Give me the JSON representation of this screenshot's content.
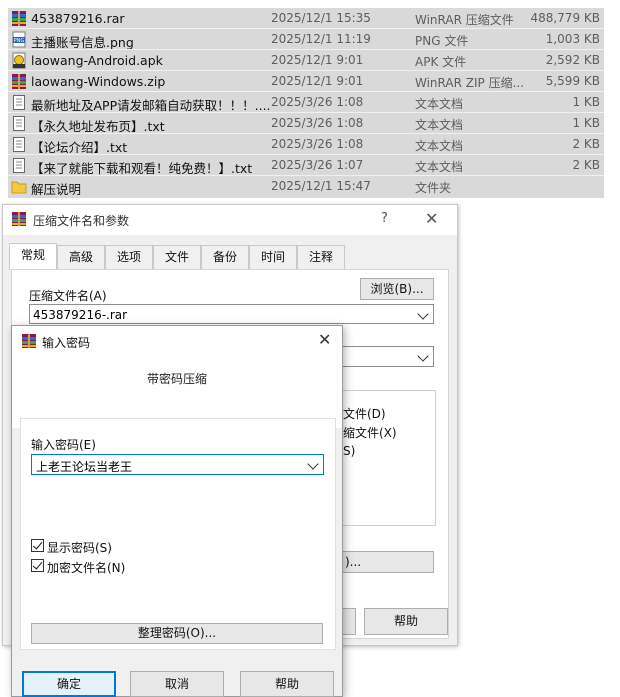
{
  "file_list": [
    {
      "name": "453879216.rar",
      "date": "2025/12/1 15:35",
      "type": "WinRAR 压缩文件",
      "size": "488,779 KB",
      "icon": "rar-icon"
    },
    {
      "name": "主播账号信息.png",
      "date": "2025/12/1 11:19",
      "type": "PNG 文件",
      "size": "1,003 KB",
      "icon": "png-icon"
    },
    {
      "name": "laowang-Android.apk",
      "date": "2025/12/1 9:01",
      "type": "APK 文件",
      "size": "2,592 KB",
      "icon": "apk-icon"
    },
    {
      "name": "laowang-Windows.zip",
      "date": "2025/12/1 9:01",
      "type": "WinRAR ZIP 压缩...",
      "size": "5,599 KB",
      "icon": "zip-icon"
    },
    {
      "name": "最新地址及APP请发邮箱自动获取！！！....",
      "date": "2025/3/26 1:08",
      "type": "文本文档",
      "size": "1 KB",
      "icon": "txt-icon"
    },
    {
      "name": "【永久地址发布页】.txt",
      "date": "2025/3/26 1:08",
      "type": "文本文档",
      "size": "1 KB",
      "icon": "txt-icon"
    },
    {
      "name": "【论坛介绍】.txt",
      "date": "2025/3/26 1:08",
      "type": "文本文档",
      "size": "2 KB",
      "icon": "txt-icon"
    },
    {
      "name": "【来了就能下载和观看！纯免费！】.txt",
      "date": "2025/3/26 1:07",
      "type": "文本文档",
      "size": "2 KB",
      "icon": "txt-icon"
    },
    {
      "name": "解压说明",
      "date": "2025/12/1 15:47",
      "type": "文件夹",
      "size": "",
      "icon": "folder-icon"
    }
  ],
  "archive_dialog": {
    "title": "压缩文件名和参数",
    "help_glyph": "?",
    "close_glyph": "✕",
    "tabs": [
      "常规",
      "高级",
      "选项",
      "文件",
      "备份",
      "时间",
      "注释"
    ],
    "archive_name_label": "压缩文件名(A)",
    "browse_label": "浏览(B)...",
    "archive_name_value": "453879216-.rar",
    "partial_option_1": "文件(D)",
    "partial_option_2": "缩文件(X)",
    "partial_option_3": "S)",
    "partial_button": ")...",
    "help_label": "帮助"
  },
  "password_dialog": {
    "title": "输入密码",
    "close_glyph": "✕",
    "heading": "带密码压缩",
    "password_label": "输入密码(E)",
    "password_value": "上老王论坛当老王",
    "show_password_label": "显示密码(S)",
    "show_password_checked": true,
    "encrypt_names_label": "加密文件名(N)",
    "encrypt_names_checked": true,
    "organize_label": "整理密码(O)...",
    "ok_label": "确定",
    "cancel_label": "取消",
    "help_label": "帮助"
  },
  "colors": {
    "accent": "#0078d7",
    "list_bg": "#d9d9d9",
    "dialog_bg": "#f0f0f0"
  }
}
